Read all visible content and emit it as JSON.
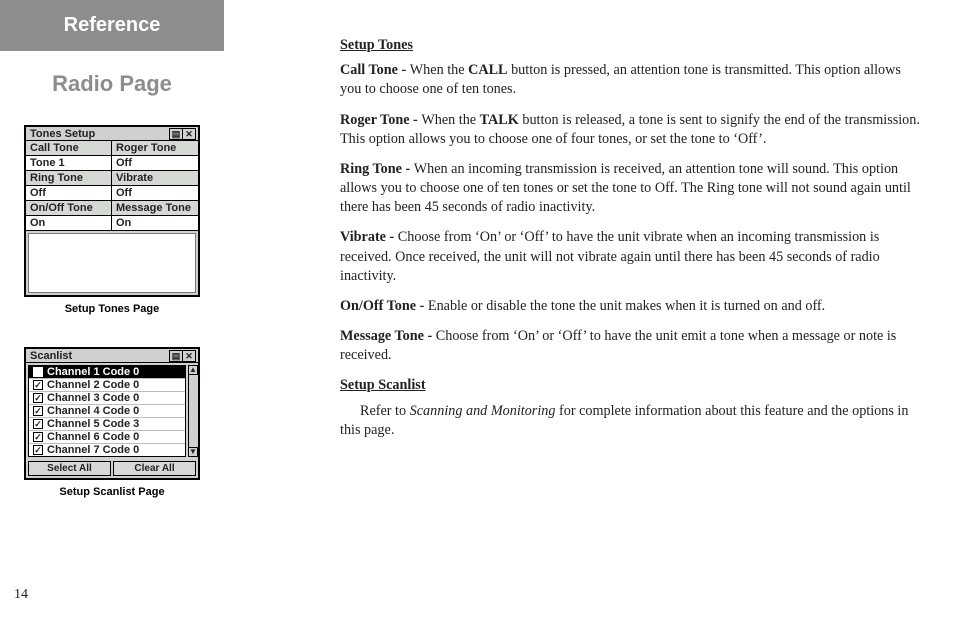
{
  "left": {
    "reference": "Reference",
    "title": "Radio Page",
    "pageNum": "14",
    "fig1": {
      "title": "Tones Setup",
      "rows": [
        [
          "Call Tone",
          "Roger Tone"
        ],
        [
          "Tone 1",
          "Off"
        ],
        [
          "Ring Tone",
          "Vibrate"
        ],
        [
          "Off",
          "Off"
        ],
        [
          "On/Off Tone",
          "Message Tone"
        ],
        [
          "On",
          "On"
        ]
      ],
      "caption": "Setup Tones Page"
    },
    "fig2": {
      "title": "Scanlist",
      "items": [
        "Channel 1  Code 0",
        "Channel 2  Code 0",
        "Channel 3  Code 0",
        "Channel 4  Code 0",
        "Channel 5  Code 3",
        "Channel 6  Code 0",
        "Channel 7  Code 0"
      ],
      "btnSelect": "Select All",
      "btnClear": "Clear All",
      "caption": "Setup Scanlist Page"
    }
  },
  "right": {
    "h1": "Setup Tones",
    "p1_lead": "Call Tone - ",
    "p1_a": "When the ",
    "p1_b": "CALL",
    "p1_c": " button is pressed, an attention tone is transmitted.  This option allows you to choose one of ten tones.",
    "p2_lead": "Roger Tone - ",
    "p2_a": "When the ",
    "p2_b": "TALK",
    "p2_c": " button is released, a tone is sent to signify the end of the transmission.  This option allows you to choose one of four tones, or set the tone to ‘Off’.",
    "p3_lead": "Ring Tone - ",
    "p3": "When an incoming transmission is received, an attention tone will sound.  This option allows you to choose one of ten tones or set the tone to Off.  The Ring tone will not sound again until there has been 45 seconds of radio inactivity.",
    "p4_lead": "Vibrate - ",
    "p4": "Choose from ‘On’ or ‘Off’ to have the unit vibrate when an incoming transmission is received.  Once received, the unit will not vibrate again until there has been 45 seconds of radio inactivity.",
    "p5_lead": "On/Off Tone - ",
    "p5": "Enable or disable the tone the unit makes when it is turned on and off.",
    "p6_lead": "Message Tone - ",
    "p6": "Choose from ‘On’ or ‘Off’ to have the unit emit a tone when a message or note is received.",
    "h2": "Setup Scanlist",
    "p7_a": "Refer to ",
    "p7_b": "Scanning and Monitoring",
    "p7_c": " for complete information about this feature and the options in this page."
  }
}
